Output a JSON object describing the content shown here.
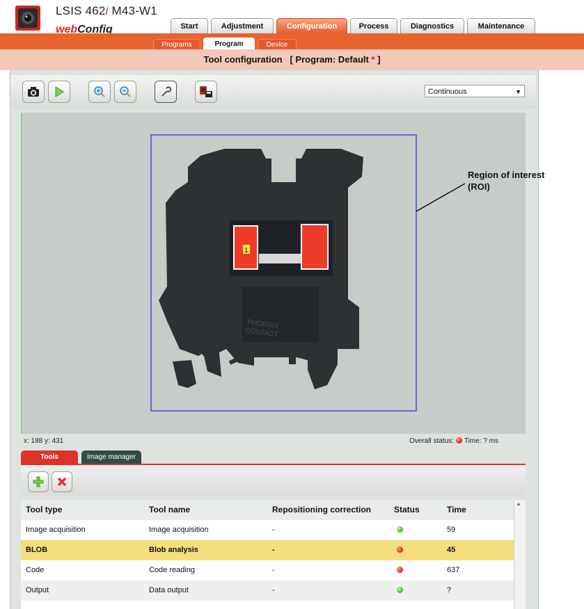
{
  "header": {
    "product_name_prefix": "LSIS 462",
    "product_name_italic": "i",
    "product_name_suffix": " M43-W1",
    "brand_prefix": "web",
    "brand_suffix": "Config"
  },
  "main_tabs": [
    {
      "label": "Start"
    },
    {
      "label": "Adjustment"
    },
    {
      "label": "Configuration",
      "active": true
    },
    {
      "label": "Process"
    },
    {
      "label": "Diagnostics"
    },
    {
      "label": "Maintenance"
    }
  ],
  "sub_tabs": [
    {
      "label": "Programs"
    },
    {
      "label": "Program",
      "active": true
    },
    {
      "label": "Device"
    }
  ],
  "title": {
    "main": "Tool configuration",
    "program_prefix": "[ Program: Default ",
    "modified_mark": "*",
    "program_suffix": " ]"
  },
  "toolbar": {
    "icons": [
      "camera-icon",
      "play-icon",
      "zoom-in-icon",
      "zoom-out-icon",
      "wrench-icon",
      "save-to-device-icon"
    ],
    "mode_select_value": "Continuous"
  },
  "image_view": {
    "roi_callout_line1": "Region of interest",
    "roi_callout_line2": "(ROI)",
    "blob_label": "1",
    "part_text_line1": "PHOENIX",
    "part_text_line2": "CONTACT"
  },
  "status_bar": {
    "coords": "x: 188 y: 431",
    "overall_status_label": "Overall status:",
    "overall_status_color": "red",
    "time_label": "Time: ? ms"
  },
  "bottom_tabs": [
    {
      "label": "Tools",
      "active": true
    },
    {
      "label": "Image manager"
    }
  ],
  "tools_toolbar": {
    "icons": [
      "add-icon",
      "delete-icon"
    ]
  },
  "table": {
    "columns": [
      "Tool type",
      "Tool name",
      "Repositioning correction",
      "Status",
      "Time"
    ],
    "rows": [
      {
        "type": "Image acquisition",
        "name": "Image acquisition",
        "repositioning": "-",
        "status": "green",
        "time": "59"
      },
      {
        "type": "BLOB",
        "name": "Blob analysis",
        "repositioning": "-",
        "status": "red",
        "time": "45",
        "selected": true
      },
      {
        "type": "Code",
        "name": "Code reading",
        "repositioning": "-",
        "status": "red",
        "time": "637"
      },
      {
        "type": "Output",
        "name": "Data output",
        "repositioning": "-",
        "status": "green",
        "time": "?"
      }
    ]
  },
  "colors": {
    "accent": "#e8632f",
    "title_band": "#f4c8b8",
    "selected_row": "#f7de7d",
    "status_red": "#d42418",
    "status_green": "#3bb51e",
    "roi": "#3a4bd6"
  }
}
